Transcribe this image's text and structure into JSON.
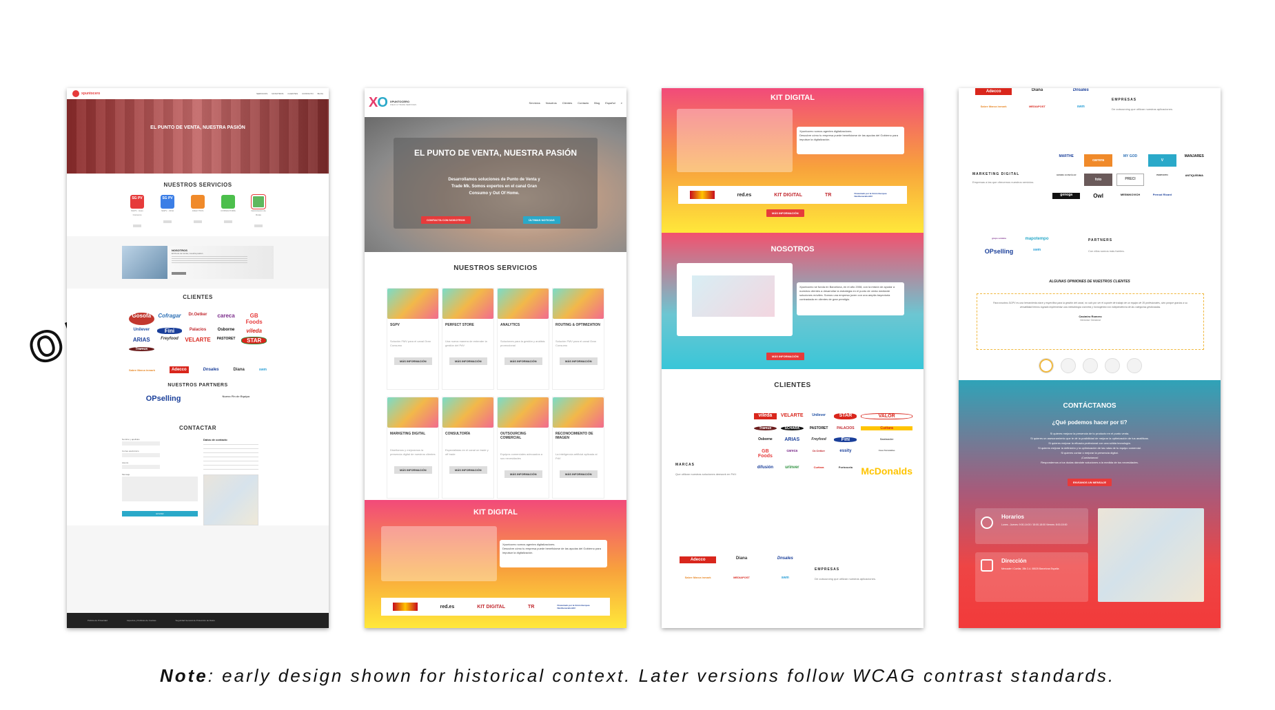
{
  "old_label": "OLD",
  "note": {
    "bold": "Note",
    "text": ": early design shown for historical context. Later versions follow WCAG contrast standards."
  },
  "colors": {
    "red": "#e63b3b",
    "pink": "#f24a7a",
    "yellow": "#ffe83a",
    "teal": "#39c6d8",
    "dark": "#222222"
  },
  "shot1": {
    "brand": "xpuntocero",
    "nav": [
      "SERVICIOS",
      "NOSOTROS",
      "CLIENTES",
      "CONTACTO",
      "BLOG"
    ],
    "hero_title": "EL PUNTO DE VENTA, NUESTRA PASIÓN",
    "services_title": "NUESTROS SERVICIOS",
    "services": [
      {
        "label": "SGPV - Gran Consumo",
        "icon": "SG PV",
        "color": "#e63b3b"
      },
      {
        "label": "SGPV - OOH",
        "icon": "SG PV",
        "color": "#3b7ee6"
      },
      {
        "label": "ANALYTICS",
        "icon": "chart",
        "color": "#f08a2a"
      },
      {
        "label": "CONSULTORÍA",
        "icon": "chat",
        "color": "#4cbf4c"
      },
      {
        "label": "Optimización de Rutas",
        "icon": "map",
        "color": "#5fb85f"
      }
    ],
    "about_title": "NOSOTROS",
    "about_sub": "El Punto de Venta, nuestra pasión",
    "clients_title": "CLIENTES",
    "client_logos": [
      "Gosofa",
      "Cofragar",
      "Dr.Oetker",
      "careca",
      "GB Foods",
      "Unilever",
      "Fini",
      "Palacios",
      "Osborne",
      "vileda",
      "ARIAS",
      "Freyfood",
      "VELARTE",
      "PASTORET",
      "STAR",
      "Tramux"
    ],
    "companies_logos": [
      "Sabre Marca inmark",
      "Adecco",
      "Dnsales",
      "Diana",
      "swm"
    ],
    "partners_title": "NUESTROS PARTNERS",
    "partners": [
      "OPselling",
      "Nuevo Fin de Equipo"
    ],
    "contact_title": "CONTACTAR",
    "form_labels": [
      "Nombre y apellidos",
      "Correo electrónico",
      "Asunto",
      "Mensaje"
    ],
    "contact_info_title": "Datos de contacto",
    "send": "ENVIAR",
    "footer": [
      "Política de Privacidad",
      "Aspectos y Políticas de Cookies",
      "Seguridad General de Protección de Datos"
    ]
  },
  "shot2": {
    "brand": "XPUNTOCERO",
    "brand_sub": "FIELD & TRADE SERVICES",
    "nav": [
      "Servicios",
      "Nosotros",
      "Clientes",
      "Contacto",
      "Blog",
      "Español"
    ],
    "hero_title": "EL PUNTO DE VENTA, NUESTRA PASIÓN",
    "hero_text": "Desarrollamos soluciones de Punto de Venta y Trade Mk. Somos expertos en el canal Gran Consumo y Out Of Home.",
    "hero_btn1": "CONTACTA CON NOSOTROS",
    "hero_btn2": "ÚLTIMAS NOTICIAS",
    "services_title": "NUESTROS SERVICIOS",
    "services": [
      {
        "title": "SGPV",
        "desc": "Solución FMV para el canal Gran Consumo"
      },
      {
        "title": "PERFECT STORE",
        "desc": "Una nueva manera de entender la gestión del PdV"
      },
      {
        "title": "ANALYTICS",
        "desc": "Soluciones para la gestión y análisis promocional"
      },
      {
        "title": "ROUTING & OPTIMIZATION",
        "desc": "Solución FMV para el canal Gran Consumo"
      },
      {
        "title": "MARKETING DIGITAL",
        "desc": "Diseñamos y mejoramos la presencia digital de nuestros clientes"
      },
      {
        "title": "CONSULTORÍA",
        "desc": "Especialistas en el canal on trade y off trade"
      },
      {
        "title": "OUTSOURCING COMERCIAL",
        "desc": "Equipos comerciales adecuados a sus necesidades"
      },
      {
        "title": "RECONOCIMIENTO DE IMAGEN",
        "desc": "La inteligencia artificial aplicada al PdV"
      }
    ],
    "more": "MÁS INFORMACIÓN",
    "kit_title": "KIT DIGITAL",
    "kit_text1": "Xpuntocero somos agentes digitalizadores.",
    "kit_text2": "Descubre cómo tu empresa puede beneficiarse de las ayudas del Gobierno para impulsar la digitalización.",
    "kit_logos": [
      "red.es",
      "KIT DIGITAL",
      "TR",
      "Financiado por la Unión Europea NextGenerationEU"
    ]
  },
  "shot3": {
    "kit_title": "KIT DIGITAL",
    "kit_text1": "Xpuntocero somos agentes digitalizadores.",
    "kit_text2": "Descubre cómo tu empresa puede beneficiarse de las ayudas del Gobierno para impulsar la digitalización.",
    "kit_logos": [
      "red.es",
      "KIT DIGITAL",
      "TR",
      "Financiado por la Unión Europea NextGenerationEU"
    ],
    "more": "MÁS INFORMACIÓN",
    "about_title": "NOSOTROS",
    "about_text": "Xpuntocero se funda en Barcelona, en el año 2008, con la misión de ayudar a nuestros clientes a desarrollar la estrategia en el punto de venta mediante soluciones móviles. Somos una empresa joven con una amplia trayectoria contrastada en clientes de gran prestigio.",
    "clients_title": "CLIENTES",
    "marcas_label": "MARCAS",
    "marcas_text": "Que utilizan nuestras soluciones deework en PdV.",
    "client_logos": [
      "vileda",
      "VELARTE",
      "Unilever",
      "STAR",
      "VALOR",
      "Tramux",
      "SCHARA",
      "PASTORET",
      "PALACIOS",
      "Cuétara",
      "Osborne",
      "ARIAS",
      "Freyfood",
      "Fini",
      "Santander",
      "GB Foods",
      "careca",
      "Dr.Oetker",
      "essity",
      "Casa Tarradellas",
      "difusión",
      "urinver",
      "Cuétara",
      "Portezuela",
      "McDonalds"
    ],
    "empresas_label": "EMPRESAS",
    "empresas_text": "De outsourcing que utilizan nuestras aplicaciones.",
    "empresas_logos": [
      "Adecco",
      "Diana",
      "Dnsales",
      "Sabre Marca inmark",
      "MEDIAPOST",
      "swm"
    ]
  },
  "shot4": {
    "empresas_logos": [
      "Adecco",
      "Diana",
      "Dnsales",
      "Sabre Marca inmark",
      "MEDIAPOST",
      "swm"
    ],
    "empresas_label": "EMPRESAS",
    "empresas_text": "De outsourcing que utilizan nuestras aplicaciones.",
    "marketing_label": "MARKETING DIGITAL",
    "marketing_text": "Empresas a las que ofrecemos nuestros servicios.",
    "marketing_logos": [
      "MARTHE",
      "carrera",
      "MY GOD",
      "V",
      "MANJARES",
      "GEMMA GONZÁLEZ",
      "foto",
      "PRECI",
      "PERPUNTO",
      "ANTIQUÍSIMA",
      "genoga",
      "Owl",
      "MESNIKOVICH",
      "Pernod Ricard"
    ],
    "partners_label": "PARTNERS",
    "partners_text": "Con ellos somos más fuertes.",
    "partners_logos": [
      "grupo solutica",
      "mapotempo",
      "OPselling",
      "swm"
    ],
    "opinions_title": "ALGUNAS OPINIONES DE NUESTROS CLIENTES",
    "opinion_text": "Para nosotros SGPV es una herramienta clave y específica para la gestión del canal, no sólo por ser el soporte de trabajo de un equipo de 35 profesionales, sino porque gracias a su versatilidad hemos logrado implementar una metodología concreta y homogénea con independencia de las categorías gestionadas.",
    "opinion_author": "Casimiro Romero",
    "opinion_role": "Director General",
    "contact_title": "CONTÁCTANOS",
    "contact_question": "¿Qué podemos hacer por ti?",
    "contact_lines": [
      "Si quieres mejorar la presencia de tu producto en el punto venta.",
      "Si quieres un asesoramiento que te dé la posibilidad de mejorar la optimización de tus analíticas.",
      "Si quieres mejorar la eficacia profesional con una sólida tecnología.",
      "Si quieres mejorar la definición y la optimización de las rutas de tu equipo comercial.",
      "Si quieres contar o mejorar la presencia digital.",
      "¡Contáctanos!",
      "Respondemos a tus dudas dándote soluciones a la medida de tus necesidades."
    ],
    "send": "ENVÍANOS UN MENSAJE",
    "hours_title": "Horarios",
    "hours_text": "Lunes - Jueves: 9:00-14:00 / 15:00-18:00 Viernes: 8:00-15:00",
    "address_title": "Dirección",
    "address_text": "Mercader i Cuellar, 28b 2-4. 08025 Barcelona España"
  }
}
